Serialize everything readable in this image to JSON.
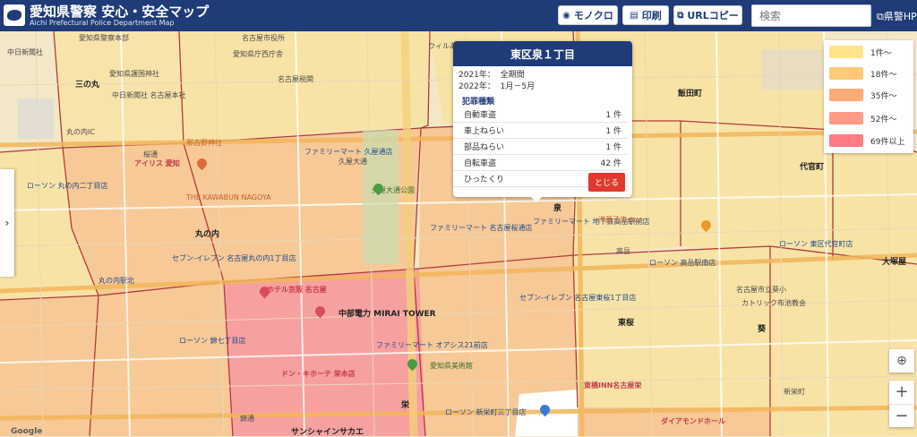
{
  "header": {
    "title": "愛知県警察 安心・安全マップ",
    "subtitle": "Aichi Prefectural Police Department Map",
    "buttons": {
      "monochrome": "モノクロ",
      "print": "印刷",
      "url_copy": "URLコピー"
    },
    "search_placeholder": "検索",
    "hp_link": "県警HP",
    "icons": {
      "monochrome": "target-icon",
      "print": "printer-icon",
      "url_copy": "copy-icon",
      "hp_link": "external-link-icon"
    }
  },
  "popup": {
    "title": "東区泉１丁目",
    "period_2021_label": "2021年：",
    "period_2021_value": "全期間",
    "period_2022_label": "2022年：",
    "period_2022_value": "1月－5月",
    "crime_type_heading": "犯罪種類",
    "rows": [
      {
        "name": "自動車盗",
        "count": "1 件"
      },
      {
        "name": "車上ねらい",
        "count": "1 件"
      },
      {
        "name": "部品ねらい",
        "count": "1 件"
      },
      {
        "name": "自転車盗",
        "count": "42 件"
      },
      {
        "name": "ひったくり",
        "count": "1 件"
      }
    ],
    "close_label": "とじる"
  },
  "legend": {
    "items": [
      {
        "label": "1件～",
        "color": "#ffe48a"
      },
      {
        "label": "18件～",
        "color": "#ffc978"
      },
      {
        "label": "35件～",
        "color": "#ffab78"
      },
      {
        "label": "52件～",
        "color": "#ff9a86"
      },
      {
        "label": "69件以上",
        "color": "#ff7a85"
      }
    ]
  },
  "map": {
    "labels": [
      "愛知県警察本部",
      "中日新聞社",
      "三の丸",
      "名古屋市役所",
      "ウィルあいち",
      "愛知県庁西庁舎",
      "愛知県護国神社",
      "名古屋税関",
      "中日新聞社 名古屋本社",
      "丸の内IC",
      "那古野神社",
      "アイリス 愛知",
      "ローソン 丸の内二丁目店",
      "THE KAWABUN NAGOYA",
      "ファミリーマート 久屋通店",
      "丸の内",
      "久屋大通公園",
      "ファミリーマート 名古屋桜通店",
      "ファミリーマート 地下鉄高岳駅前店",
      "洋菓子店slow",
      "ローソン 高岳駅南店",
      "ローソン 東区代官町店",
      "代官町",
      "飯田町",
      "セブン-イレブン 名古屋丸の内1丁目店",
      "ホテル京阪 名古屋",
      "中部電力 MIRAI TOWER",
      "セブン-イレブン 名古屋東桜1丁目店",
      "名古屋市立葵小",
      "カトリック布池教会",
      "東桜",
      "葵",
      "ローソン 錦七丁目店",
      "ファミリーマート オアシス21前店",
      "愛知県美術館",
      "東横INN名古屋栄",
      "ドン・キホーテ 栄本店",
      "ローソン 新栄町三丁目店",
      "サンシャインサカエ",
      "ダイアモンドホール",
      "大塚屋",
      "丸の内駅北",
      "泉",
      "栄",
      "錦通",
      "桜通",
      "久屋大通",
      "新栄町",
      "高岳"
    ]
  }
}
